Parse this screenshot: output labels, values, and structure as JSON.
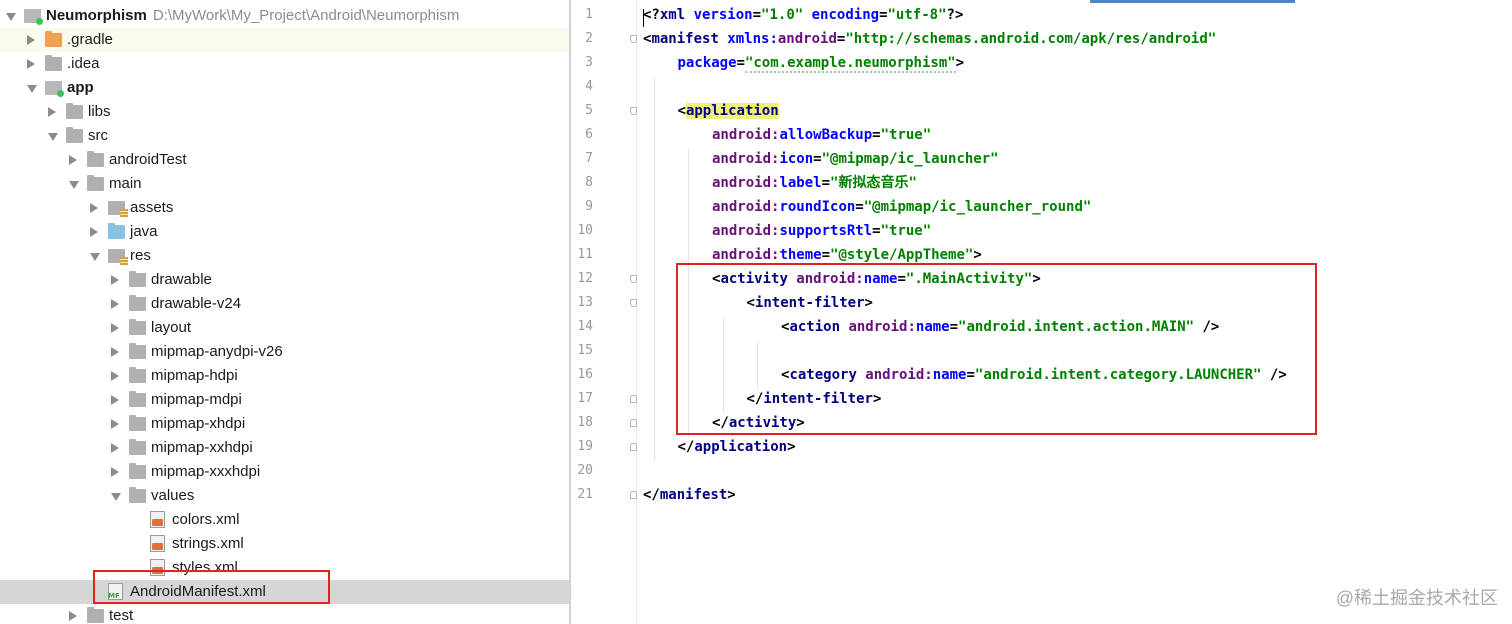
{
  "tree": {
    "items": [
      {
        "label": "Neumorphism",
        "path": "D:\\MyWork\\My_Project\\Android\\Neumorphism",
        "depth": 0,
        "arrow": "open",
        "icon": "module",
        "bold": true
      },
      {
        "label": ".gradle",
        "depth": 1,
        "arrow": "closed",
        "icon": "folder-orange",
        "highlight": true
      },
      {
        "label": ".idea",
        "depth": 1,
        "arrow": "closed",
        "icon": "folder"
      },
      {
        "label": "app",
        "depth": 1,
        "arrow": "open",
        "icon": "module",
        "bold": true
      },
      {
        "label": "libs",
        "depth": 2,
        "arrow": "closed",
        "icon": "folder"
      },
      {
        "label": "src",
        "depth": 2,
        "arrow": "open",
        "icon": "folder"
      },
      {
        "label": "androidTest",
        "depth": 3,
        "arrow": "closed",
        "icon": "folder"
      },
      {
        "label": "main",
        "depth": 3,
        "arrow": "open",
        "icon": "folder"
      },
      {
        "label": "assets",
        "depth": 4,
        "arrow": "closed",
        "icon": "res"
      },
      {
        "label": "java",
        "depth": 4,
        "arrow": "closed",
        "icon": "folder-blue"
      },
      {
        "label": "res",
        "depth": 4,
        "arrow": "open",
        "icon": "res"
      },
      {
        "label": "drawable",
        "depth": 5,
        "arrow": "closed",
        "icon": "folder"
      },
      {
        "label": "drawable-v24",
        "depth": 5,
        "arrow": "closed",
        "icon": "folder"
      },
      {
        "label": "layout",
        "depth": 5,
        "arrow": "closed",
        "icon": "folder"
      },
      {
        "label": "mipmap-anydpi-v26",
        "depth": 5,
        "arrow": "closed",
        "icon": "folder"
      },
      {
        "label": "mipmap-hdpi",
        "depth": 5,
        "arrow": "closed",
        "icon": "folder"
      },
      {
        "label": "mipmap-mdpi",
        "depth": 5,
        "arrow": "closed",
        "icon": "folder"
      },
      {
        "label": "mipmap-xhdpi",
        "depth": 5,
        "arrow": "closed",
        "icon": "folder"
      },
      {
        "label": "mipmap-xxhdpi",
        "depth": 5,
        "arrow": "closed",
        "icon": "folder"
      },
      {
        "label": "mipmap-xxxhdpi",
        "depth": 5,
        "arrow": "closed",
        "icon": "folder"
      },
      {
        "label": "values",
        "depth": 5,
        "arrow": "open",
        "icon": "folder"
      },
      {
        "label": "colors.xml",
        "depth": 6,
        "arrow": "none",
        "icon": "file"
      },
      {
        "label": "strings.xml",
        "depth": 6,
        "arrow": "none",
        "icon": "file"
      },
      {
        "label": "styles.xml",
        "depth": 6,
        "arrow": "none",
        "icon": "file"
      },
      {
        "label": "AndroidManifest.xml",
        "depth": 4,
        "arrow": "none",
        "icon": "mf",
        "selected": true
      },
      {
        "label": "test",
        "depth": 3,
        "arrow": "closed",
        "icon": "folder"
      }
    ]
  },
  "editor": {
    "lines": [
      {
        "num": "1",
        "indent": 0,
        "parts": [
          {
            "t": "<?",
            "c": "pn"
          },
          {
            "t": "xml ",
            "c": "tg"
          },
          {
            "t": "version",
            "c": "an2"
          },
          {
            "t": "=",
            "c": "pn"
          },
          {
            "t": "\"1.0\"",
            "c": "av"
          },
          {
            "t": " ",
            "c": "pn"
          },
          {
            "t": "encoding",
            "c": "an2"
          },
          {
            "t": "=",
            "c": "pn"
          },
          {
            "t": "\"utf-8\"",
            "c": "av"
          },
          {
            "t": "?>",
            "c": "pn"
          }
        ]
      },
      {
        "num": "2",
        "indent": 0,
        "parts": [
          {
            "t": "<",
            "c": "pn"
          },
          {
            "t": "manifest ",
            "c": "tg"
          },
          {
            "t": "xmlns:",
            "c": "an2"
          },
          {
            "t": "android",
            "c": "an"
          },
          {
            "t": "=",
            "c": "pn"
          },
          {
            "t": "\"http://schemas.android.com/apk/res/android\"",
            "c": "av"
          }
        ]
      },
      {
        "num": "3",
        "indent": 1,
        "parts": [
          {
            "t": "package",
            "c": "an2"
          },
          {
            "t": "=",
            "c": "pn"
          },
          {
            "t": "\"com.example.neumorphism\"",
            "c": "av squig"
          },
          {
            "t": ">",
            "c": "pn"
          }
        ]
      },
      {
        "num": "4",
        "indent": 0,
        "parts": []
      },
      {
        "num": "5",
        "indent": 1,
        "parts": [
          {
            "t": "<",
            "c": "pn"
          },
          {
            "t": "application",
            "c": "tg hl-app"
          }
        ]
      },
      {
        "num": "6",
        "indent": 2,
        "parts": [
          {
            "t": "android:",
            "c": "an"
          },
          {
            "t": "allowBackup",
            "c": "an2"
          },
          {
            "t": "=",
            "c": "pn"
          },
          {
            "t": "\"true\"",
            "c": "av"
          }
        ]
      },
      {
        "num": "7",
        "indent": 2,
        "parts": [
          {
            "t": "android:",
            "c": "an"
          },
          {
            "t": "icon",
            "c": "an2"
          },
          {
            "t": "=",
            "c": "pn"
          },
          {
            "t": "\"@mipmap/ic_launcher\"",
            "c": "av"
          }
        ]
      },
      {
        "num": "8",
        "indent": 2,
        "parts": [
          {
            "t": "android:",
            "c": "an"
          },
          {
            "t": "label",
            "c": "an2"
          },
          {
            "t": "=",
            "c": "pn"
          },
          {
            "t": "\"新拟态音乐\"",
            "c": "av"
          }
        ]
      },
      {
        "num": "9",
        "indent": 2,
        "parts": [
          {
            "t": "android:",
            "c": "an"
          },
          {
            "t": "roundIcon",
            "c": "an2"
          },
          {
            "t": "=",
            "c": "pn"
          },
          {
            "t": "\"@mipmap/ic_launcher_round\"",
            "c": "av"
          }
        ]
      },
      {
        "num": "10",
        "indent": 2,
        "parts": [
          {
            "t": "android:",
            "c": "an"
          },
          {
            "t": "supportsRtl",
            "c": "an2"
          },
          {
            "t": "=",
            "c": "pn"
          },
          {
            "t": "\"true\"",
            "c": "av"
          }
        ]
      },
      {
        "num": "11",
        "indent": 2,
        "parts": [
          {
            "t": "android:",
            "c": "an"
          },
          {
            "t": "theme",
            "c": "an2"
          },
          {
            "t": "=",
            "c": "pn"
          },
          {
            "t": "\"@style/AppTheme\"",
            "c": "av"
          },
          {
            "t": ">",
            "c": "pn"
          }
        ]
      },
      {
        "num": "12",
        "indent": 2,
        "parts": [
          {
            "t": "<",
            "c": "pn"
          },
          {
            "t": "activity ",
            "c": "tg"
          },
          {
            "t": "android:",
            "c": "an"
          },
          {
            "t": "name",
            "c": "an2"
          },
          {
            "t": "=",
            "c": "pn"
          },
          {
            "t": "\".MainActivity\"",
            "c": "av"
          },
          {
            "t": ">",
            "c": "pn"
          }
        ]
      },
      {
        "num": "13",
        "indent": 3,
        "parts": [
          {
            "t": "<",
            "c": "pn"
          },
          {
            "t": "intent-filter",
            "c": "tg"
          },
          {
            "t": ">",
            "c": "pn"
          }
        ]
      },
      {
        "num": "14",
        "indent": 4,
        "parts": [
          {
            "t": "<",
            "c": "pn"
          },
          {
            "t": "action ",
            "c": "tg"
          },
          {
            "t": "android:",
            "c": "an"
          },
          {
            "t": "name",
            "c": "an2"
          },
          {
            "t": "=",
            "c": "pn"
          },
          {
            "t": "\"android.intent.action.MAIN\"",
            "c": "av"
          },
          {
            "t": " />",
            "c": "pn"
          }
        ]
      },
      {
        "num": "15",
        "indent": 0,
        "parts": []
      },
      {
        "num": "16",
        "indent": 4,
        "parts": [
          {
            "t": "<",
            "c": "pn"
          },
          {
            "t": "category ",
            "c": "tg"
          },
          {
            "t": "android:",
            "c": "an"
          },
          {
            "t": "name",
            "c": "an2"
          },
          {
            "t": "=",
            "c": "pn"
          },
          {
            "t": "\"android.intent.category.LAUNCHER\"",
            "c": "av"
          },
          {
            "t": " />",
            "c": "pn"
          }
        ]
      },
      {
        "num": "17",
        "indent": 3,
        "parts": [
          {
            "t": "</",
            "c": "pn"
          },
          {
            "t": "intent-filter",
            "c": "tg"
          },
          {
            "t": ">",
            "c": "pn"
          }
        ]
      },
      {
        "num": "18",
        "indent": 2,
        "parts": [
          {
            "t": "</",
            "c": "pn"
          },
          {
            "t": "activity",
            "c": "tg"
          },
          {
            "t": ">",
            "c": "pn"
          }
        ]
      },
      {
        "num": "19",
        "indent": 1,
        "parts": [
          {
            "t": "</",
            "c": "pn"
          },
          {
            "t": "application",
            "c": "tg"
          },
          {
            "t": ">",
            "c": "pn"
          }
        ]
      },
      {
        "num": "20",
        "indent": 0,
        "parts": []
      },
      {
        "num": "21",
        "indent": 0,
        "parts": [
          {
            "t": "</",
            "c": "pn"
          },
          {
            "t": "manifest",
            "c": "tg"
          },
          {
            "t": ">",
            "c": "pn"
          }
        ]
      }
    ]
  },
  "watermark": "@稀土掘金技术社区",
  "colors": {
    "selection": "#d6d6d6",
    "row_highlight": "#fcfaed",
    "annotation_box": "#e02424",
    "tag": "#000080",
    "attr_ns": "#660e7a",
    "attr": "#0000ff",
    "value": "#008000"
  }
}
